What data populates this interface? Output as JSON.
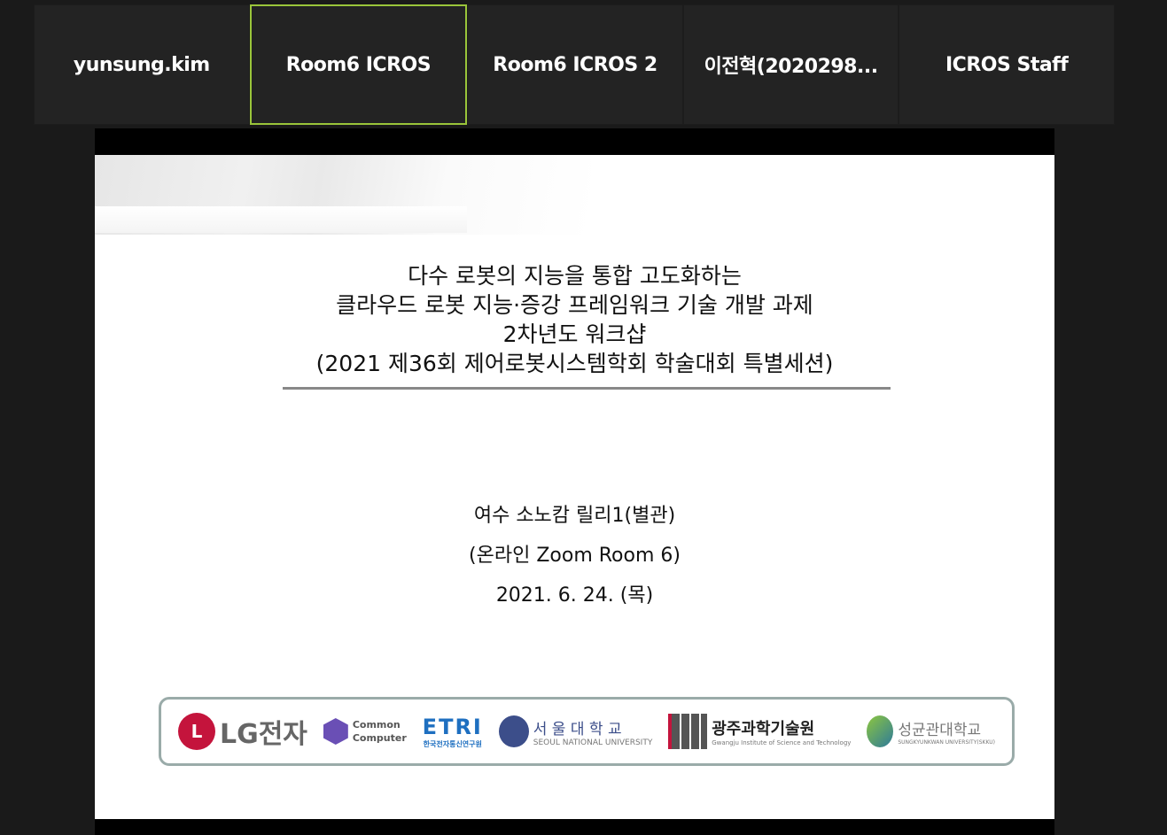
{
  "participants": [
    {
      "name": "yunsung.kim",
      "active": false
    },
    {
      "name": "Room6 ICROS",
      "active": true
    },
    {
      "name": "Room6 ICROS 2",
      "active": false
    },
    {
      "name": "이전혁(2020298...",
      "active": false
    },
    {
      "name": "ICROS Staff",
      "active": false
    }
  ],
  "accent_color": "#9ac53a",
  "slide": {
    "title_lines": [
      "다수 로봇의 지능을 통합 고도화하는",
      "클라우드 로봇 지능·증강 프레임워크 기술 개발 과제",
      "2차년도 워크샵",
      "(2021 제36회 제어로봇시스템학회 학술대회 특별세션)"
    ],
    "venue": "여수 소노캄 릴리1(별관)",
    "online": "(온라인 Zoom Room 6)",
    "date": "2021. 6. 24. (목)",
    "logos": {
      "lg": "LG전자",
      "lg_mark": "LG",
      "cc1": "Common",
      "cc2": "Computer",
      "etri": "ETRI",
      "etri_sub": "한국전자통신연구원",
      "snu": "서 울 대 학 교",
      "snu_sub": "SEOUL NATIONAL UNIVERSITY",
      "gist_mark": "GIST",
      "gist": "광주과학기술원",
      "gist_sub": "Gwangju Institute of Science and Technology",
      "skku": "성균관대학교",
      "skku_sub": "SUNGKYUNKWAN UNIVERSITY(SKKU)"
    }
  }
}
